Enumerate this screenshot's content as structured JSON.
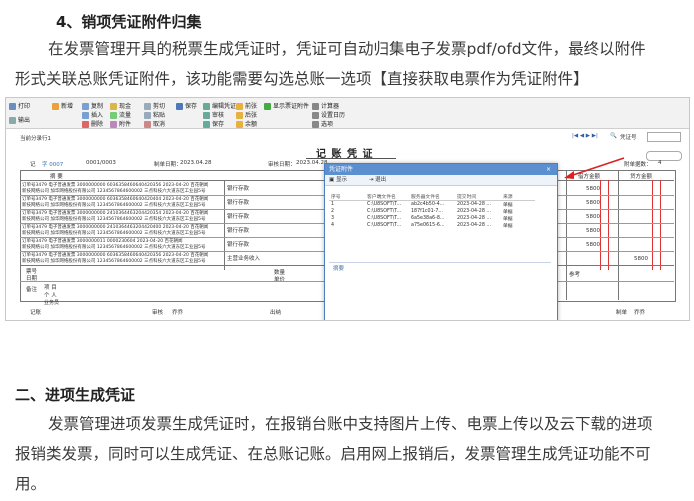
{
  "section4": {
    "title": "4、销项凭证附件归集",
    "paragraph_line1": "在发票管理开具的税票生成凭证时，凭证可自动归集电子发票pdf/ofd文件，最终以附件",
    "paragraph_line2": "形式关联总账凭证附件，该功能需要勾选总账一选项【直接获取电票作为凭证附件】"
  },
  "screenshot": {
    "toolbar": {
      "print": "打印",
      "print_sub": "输出",
      "new": "新增",
      "save": "保存",
      "copy": "复制",
      "insert": "插入",
      "delete_row": "删除",
      "cash": "现金",
      "flow": "流量",
      "attach": "附件",
      "cut": "剪切",
      "paste": "粘贴",
      "edit_voucher": "编辑凭证",
      "cancel": "取消",
      "review": "审核",
      "save2": "保存",
      "prev": "前张",
      "next": "后张",
      "balance": "余额",
      "show_attachment": "显示票证附件",
      "calculator": "计算器",
      "settings": "设置日历",
      "options": "选项"
    },
    "voucher_bar": "当前分录行1",
    "voucher_type_label": "凭证号",
    "voucher_title": "记 账 凭 证",
    "voucher_no_label": "记",
    "voucher_no": "字 0007",
    "voucher_no2": "0001/0003",
    "date_label": "制单日期：",
    "date": "2023.04.28",
    "review_date_label": "审核日期：",
    "review_date": "2023.04.28",
    "attach_count_label": "附单据数：",
    "attach_count": "4",
    "debit_label": "借方金额",
    "credit_label": "贷方金额",
    "col_summary": "摘 要",
    "rows": [
      {
        "summary": "订单号3479 电子普通发票 3000000000 6036358460640420356 2023-04-20 百花朝闻",
        "summary2": "新技网络公司 加华网络股份有限公司 1234567864600002 三点科技六大道东区工业园5号",
        "account": "银行存款",
        "amount": "5800"
      },
      {
        "summary": "订单号3479 电子普通发票 3000000000 6036358460640420404 2023-04-20 百花朝闻",
        "summary2": "新技网络公司 加华网络股份有限公司 1234567864600002 三点科技六大道东区工业园5号",
        "account": "银行存款",
        "amount": "5800"
      },
      {
        "summary": "订单号3479 电子普通发票 3000000000 2410364463204420354 2023-04-20 百花朝闻",
        "summary2": "新技网络公司 加华网络股份有限公司 1234567864600002 三点科技六大道东区工业园5号",
        "account": "银行存款",
        "amount": "5800"
      },
      {
        "summary": "订单号3479 电子普通发票 3000000000 2410364463204420400 2023-04-20 百花朝闻",
        "summary2": "新技网络公司 加华网络股份有限公司 1234567864600002 三点科技六大道东区工业园5号",
        "account": "银行存款",
        "amount": "5800"
      },
      {
        "summary": "订单号3479 电子普通发票 3000000011 0000230604 2023-04-20 百花朝闻",
        "summary2": "新技网络公司 加华网络股份有限公司 1234567864600002 三点科技六大道东区工业园5号",
        "account": "银行存款",
        "amount": "5800"
      },
      {
        "summary": "订单号3479 电子普通发票 3000000000 6036358460640420356 2023-04-20 百花朝闻",
        "summary2": "新技网络公司 加华网络股份有限公司 1234567864600002 三点科技六大道东区工业园5号",
        "account": "主营业务收入",
        "amount": "5800"
      }
    ],
    "notes_label": "票号",
    "date_row_label": "日期",
    "qty_label": "数量",
    "price_label": "单价",
    "remark_label": "备注",
    "project_label": "项 目",
    "person_label": "个 人",
    "business_label": "业务员",
    "bookkeeper_label": "记账",
    "reviewer_label": "审核",
    "reviewer": "乔乔",
    "cashier_label": "出纳",
    "maker_label": "制单",
    "maker": "乔乔",
    "dialog": {
      "title": "凭证附件",
      "close": "×",
      "tool_show": "显示",
      "tool_exit": "退出",
      "headers": [
        "序号",
        "客户端文件名",
        "服务器文件名",
        "提交时间",
        "来源"
      ],
      "rows": [
        [
          "1",
          "C:\\U8SOFT\\T...",
          "ab2c4b50-4...",
          "2023-04-28 ...",
          "单据"
        ],
        [
          "2",
          "C:\\U8SOFT\\T...",
          "187f1c01-7...",
          "2023-04-28 ...",
          "单据"
        ],
        [
          "3",
          "C:\\U8SOFT\\T...",
          "6a5e38a6-8...",
          "2023-04-28 ...",
          "单据"
        ],
        [
          "4",
          "C:\\U8SOFT\\T...",
          "a75e0615-6...",
          "2023-04-28 ...",
          "单据"
        ]
      ],
      "notes_label": "摘要"
    },
    "ref_label": "参考"
  },
  "section2": {
    "title": "二、进项生成凭证",
    "paragraph_line1": "发票管理进项发票生成凭证时，在报销台账中支持图片上传、电票上传以及云下载的进项",
    "paragraph_line2": "报销类发票，同时可以生成凭证、在总账记账。启用网上报销后，发票管理生成凭证功能不可",
    "paragraph_line3": "用。"
  }
}
